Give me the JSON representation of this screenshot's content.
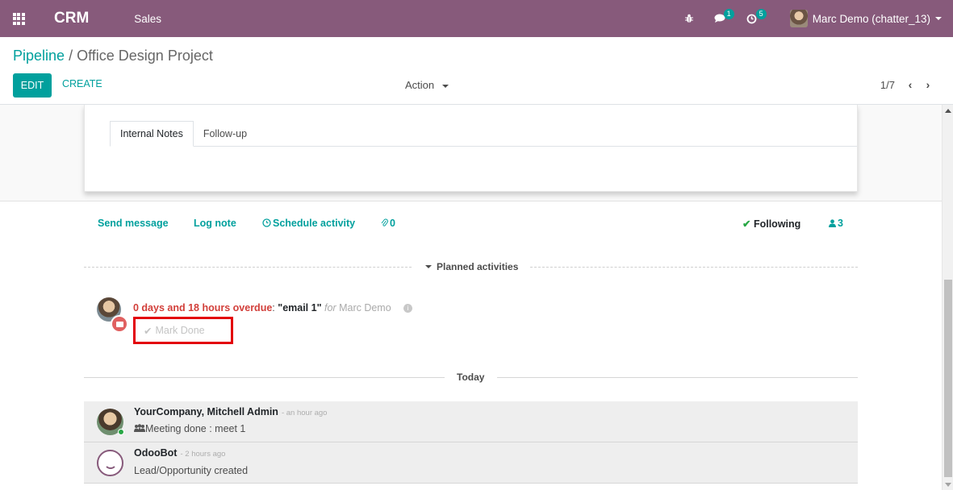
{
  "navbar": {
    "app_name": "CRM",
    "menu_sales": "Sales",
    "messages_badge": "1",
    "activities_badge": "5",
    "user_name": "Marc Demo (chatter_13)"
  },
  "control_panel": {
    "breadcrumb_root": "Pipeline",
    "breadcrumb_sep": "/",
    "breadcrumb_current": "Office Design Project",
    "edit_label": "EDIT",
    "create_label": "CREATE",
    "action_label": "Action",
    "pager_value": "1/7",
    "pager_prev": "‹",
    "pager_next": "›"
  },
  "sheet": {
    "tabs": [
      {
        "label": "Internal Notes",
        "active": true
      },
      {
        "label": "Follow-up",
        "active": false
      }
    ]
  },
  "chatter": {
    "send_message": "Send message",
    "log_note": "Log note",
    "schedule_activity": "Schedule activity",
    "attachments_count": "0",
    "following": "Following",
    "followers_count": "3",
    "planned_activities": "Planned activities",
    "activity": {
      "overdue_text": "0 days and 18 hours overdue",
      "separator": ":",
      "name": "\"email 1\"",
      "for_text": "for",
      "user": "Marc Demo",
      "mark_done": "Mark Done"
    },
    "today_label": "Today",
    "messages": [
      {
        "author": "YourCompany, Mitchell Admin",
        "date": "- an hour ago",
        "body": "Meeting done : meet 1"
      },
      {
        "author": "OdooBot",
        "date": "- 2 hours ago",
        "body": "Lead/Opportunity created"
      }
    ]
  },
  "colors": {
    "brand": "#875a7b",
    "accent": "#00a09d",
    "overdue": "#d23f3a",
    "highlight_box": "#e3000b"
  }
}
